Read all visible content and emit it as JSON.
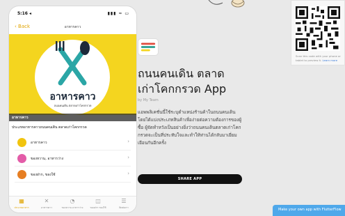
{
  "phone": {
    "status_time": "5:16 ◂",
    "status_icons": "▮▮▮ ≈ ▭",
    "back_label": "Back",
    "nav_title": "อาหารคาว",
    "hero_title": "อาหารคาว",
    "hero_sub": "ถนนคนเดิน ตลาดเก่าโคกกรวด",
    "hero_label": "อาหารคาว",
    "description": "ประเภทอาหารคาวถนนคนเดิน ตลาดเก่าโคกกรวด",
    "list_items": [
      {
        "label": "อาหารคาว",
        "icon": "dish-icon",
        "color": "#f1c40f"
      },
      {
        "label": "ของหวาน, อาหารว่าง",
        "icon": "dessert-icon",
        "color": "#e35ca8"
      },
      {
        "label": "ของฝาก, ของใช้",
        "icon": "gift-icon",
        "color": "#e67e22"
      }
    ],
    "tabs": [
      {
        "label": "ประเภทอาหาร",
        "icon": "category-icon",
        "active": true
      },
      {
        "label": "อาหารคาว",
        "icon": "dish-tab-icon",
        "active": false
      },
      {
        "label": "ของหวาน อาหารว่าง",
        "icon": "dessert-tab-icon",
        "active": false
      },
      {
        "label": "ของฝาก ของใช้",
        "icon": "gift-tab-icon",
        "active": false
      },
      {
        "label": "ติดต่อเรา",
        "icon": "menu-tab-icon",
        "active": false
      }
    ]
  },
  "app": {
    "title_line1": "ถนนคนเดิน ตลาด",
    "title_line2": "เก่าโคกกรวด App",
    "by": "by My Team",
    "description": "แอพพลิเคชั่นนี้ใช้ระบุตำแหน่งร้านค้าในถนนคนเดิน โดยได้แบ่งประเภทสินค้าเพื่อง่ายต่อความต้องการของผู้ซื้อ ผู้จัดทำหวังเป็นอย่างยิ่งว่าถนนคนเดินตลาดเก่าโคกกรวดจะเป็นที่ประทับใจและทำให้ท่านได้กลับมาเยี่ยมเยือนกันอีกครั้ง",
    "share_label": "SHARE APP"
  },
  "qr": {
    "caption_prefix": "Scan this code with your phone or tablet to preview it. ",
    "learn_more": "Learn more"
  },
  "make_own": {
    "label": "Make your own app with FlutterFlow"
  },
  "colors": {
    "hero_yellow": "#f4d51f",
    "accent": "#e0a400",
    "share_black": "#111111",
    "cta_blue": "#4fa8ea"
  }
}
